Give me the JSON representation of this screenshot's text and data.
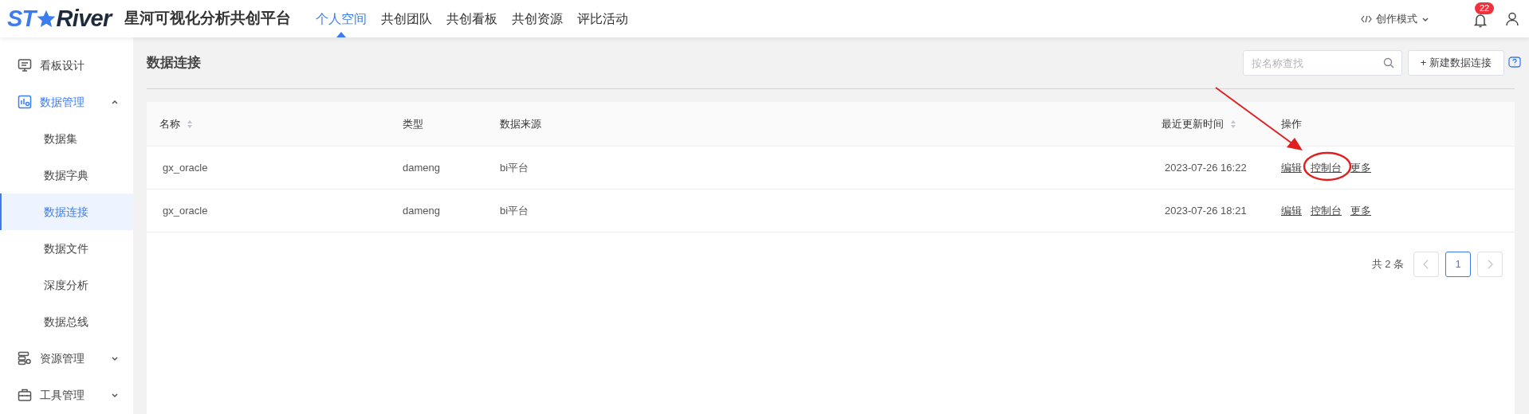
{
  "logo": {
    "left": "ST",
    "right": "River"
  },
  "app_title": "星河可视化分析共创平台",
  "nav": [
    {
      "label": "个人空间",
      "selected": true
    },
    {
      "label": "共创团队",
      "selected": false
    },
    {
      "label": "共创看板",
      "selected": false
    },
    {
      "label": "共创资源",
      "selected": false
    },
    {
      "label": "评比活动",
      "selected": false
    }
  ],
  "mode": {
    "label": "创作模式"
  },
  "notifications": {
    "badge": "22"
  },
  "sidebar": [
    {
      "kind": "dashboard",
      "label": "看板设计",
      "selected": false
    },
    {
      "kind": "data",
      "label": "数据管理",
      "expanded": true,
      "selected": false,
      "children": [
        {
          "label": "数据集",
          "selected": false
        },
        {
          "label": "数据字典",
          "selected": false
        },
        {
          "label": "数据连接",
          "selected": true
        },
        {
          "label": "数据文件",
          "selected": false
        },
        {
          "label": "深度分析",
          "selected": false
        },
        {
          "label": "数据总线",
          "selected": false
        }
      ]
    },
    {
      "kind": "resource",
      "label": "资源管理",
      "expanded": false,
      "selected": false
    },
    {
      "kind": "tool",
      "label": "工具管理",
      "expanded": false,
      "selected": false
    }
  ],
  "page_title": "数据连接",
  "search": {
    "placeholder": "按名称查找"
  },
  "new_button": "+ 新建数据连接",
  "table": {
    "columns": [
      {
        "label": "名称",
        "sortable": true
      },
      {
        "label": "类型",
        "sortable": false
      },
      {
        "label": "数据来源",
        "sortable": false
      },
      {
        "label": "最近更新时间",
        "sortable": true
      },
      {
        "label": "操作",
        "sortable": false
      }
    ],
    "rows": [
      {
        "name": "gx_oracle",
        "type": "dameng",
        "source": "bi平台",
        "updated": "2023-07-26 16:22",
        "actions": [
          {
            "label": "编辑",
            "circled": false
          },
          {
            "label": "控制台",
            "circled": true
          },
          {
            "label": "更多",
            "circled": false
          }
        ]
      },
      {
        "name": "gx_oracle",
        "type": "dameng",
        "source": "bi平台",
        "updated": "2023-07-26 18:21",
        "actions": [
          {
            "label": "编辑",
            "circled": false
          },
          {
            "label": "控制台",
            "circled": false
          },
          {
            "label": "更多",
            "circled": false
          }
        ]
      }
    ]
  },
  "pagination": {
    "total": "共 2 条",
    "pages": [
      {
        "label": "1",
        "selected": true
      }
    ]
  }
}
